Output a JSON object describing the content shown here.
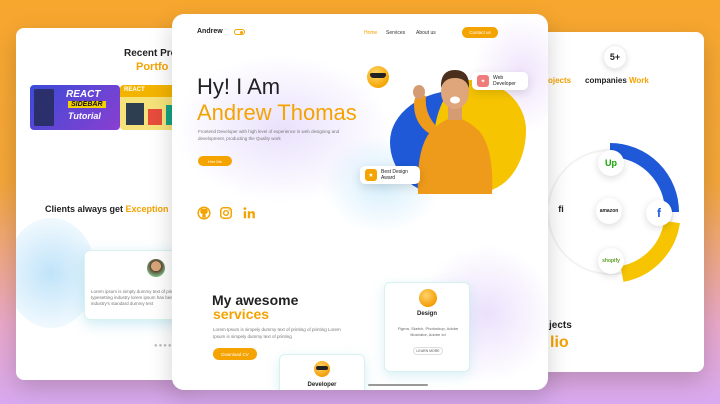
{
  "left_card": {
    "title": "Recent Pro",
    "subtitle": "Portfo",
    "thumb1": {
      "line1": "REACT",
      "line2": "SIDEBAR",
      "line3": "Tutorial"
    },
    "thumb2": {
      "label": "REACT"
    },
    "clients_text": "Clients always get ",
    "clients_highlight": "Exception",
    "testimonial_text": "Lorem ipsum is simply dummy text of printing and typesetting industry lorem ipsum has been the industry's standard dummy text",
    "dots": "●●●●"
  },
  "center_card": {
    "nav": {
      "brand": "Andrew",
      "links": [
        "Home",
        "Services",
        "About us"
      ],
      "contact": "Contact us"
    },
    "hero": {
      "greeting": "Hy! I Am",
      "name": "Andrew Thomas",
      "description": "Frontend Developer with high level of experience in web designing and development, producting the Quality work",
      "hire_button": "Hire Me"
    },
    "badges": {
      "web_developer": "Web Developer",
      "best_design_award": "Best Design Award"
    },
    "social": [
      "github-icon",
      "instagram-icon",
      "linkedin-icon"
    ],
    "services": {
      "title": "My awesome",
      "subtitle": "services",
      "description": "Lorem Ipsum is simpely dummy text of printing of printing Lorem Ipsum is simpely dummy text of printing",
      "download_button": "Download CV"
    },
    "service_cards": {
      "design": {
        "title": "Design",
        "description": "Figma, Sketch, Photoshop, Adobe Illustrator, Adobe xd",
        "button": "LEARN MORE"
      },
      "developer": {
        "title": "Developer"
      }
    }
  },
  "right_card": {
    "count": "5+",
    "projects_label": "ojects",
    "companies_text": "companies ",
    "companies_highlight": "Work",
    "logos": [
      "Up",
      "fi",
      "amazon",
      "f",
      "shopify"
    ],
    "bottom_title": "jects",
    "bottom_sub": "lio"
  },
  "colors": {
    "accent": "#f4a300",
    "blue": "#1f59d8",
    "yellow": "#f6c400",
    "background_top": "#f7a72e",
    "background_bottom": "#d8a9f0"
  }
}
